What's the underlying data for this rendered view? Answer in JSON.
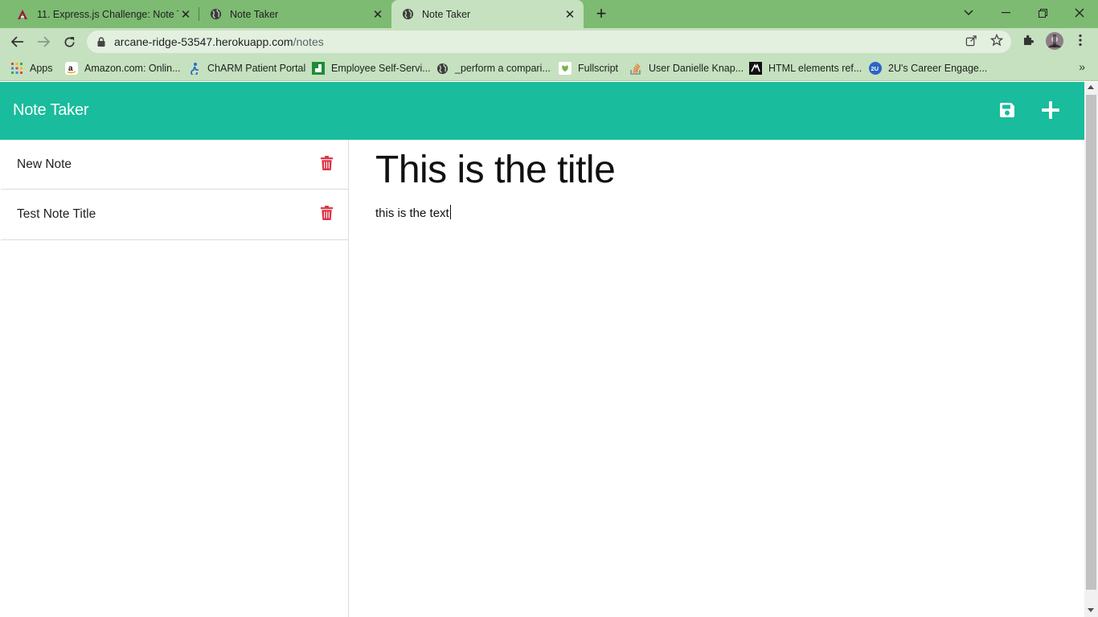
{
  "browser": {
    "tabs": [
      {
        "title": "11. Express.js Challenge: Note Tak",
        "favicon": "canvas-a-icon"
      },
      {
        "title": "Note Taker",
        "favicon": "globe-icon"
      },
      {
        "title": "Note Taker",
        "favicon": "globe-icon",
        "active": true
      }
    ],
    "url_host": "arcane-ridge-53547.herokuapp.com",
    "url_path": "/notes",
    "bookmarks": [
      {
        "label": "Apps",
        "icon": "apps-grid-icon"
      },
      {
        "label": "Amazon.com: Onlin...",
        "icon": "amazon-icon"
      },
      {
        "label": "ChARM Patient Portal",
        "icon": "charm-icon"
      },
      {
        "label": "Employee Self-Servi...",
        "icon": "employee-icon"
      },
      {
        "label": "_perform a compari...",
        "icon": "globe-icon"
      },
      {
        "label": "Fullscript",
        "icon": "fullscript-icon"
      },
      {
        "label": "User Danielle Knap...",
        "icon": "stackoverflow-icon"
      },
      {
        "label": "HTML elements ref...",
        "icon": "mdn-icon"
      },
      {
        "label": "2U's Career Engage...",
        "icon": "2u-icon"
      }
    ]
  },
  "app": {
    "brand": "Note Taker",
    "accent_color": "#19bc9c",
    "delete_color": "#dc3545",
    "notes": [
      {
        "title": "New Note"
      },
      {
        "title": "Test Note Title"
      }
    ],
    "active_note": {
      "title": "This is the title",
      "text": "this is the text"
    }
  }
}
